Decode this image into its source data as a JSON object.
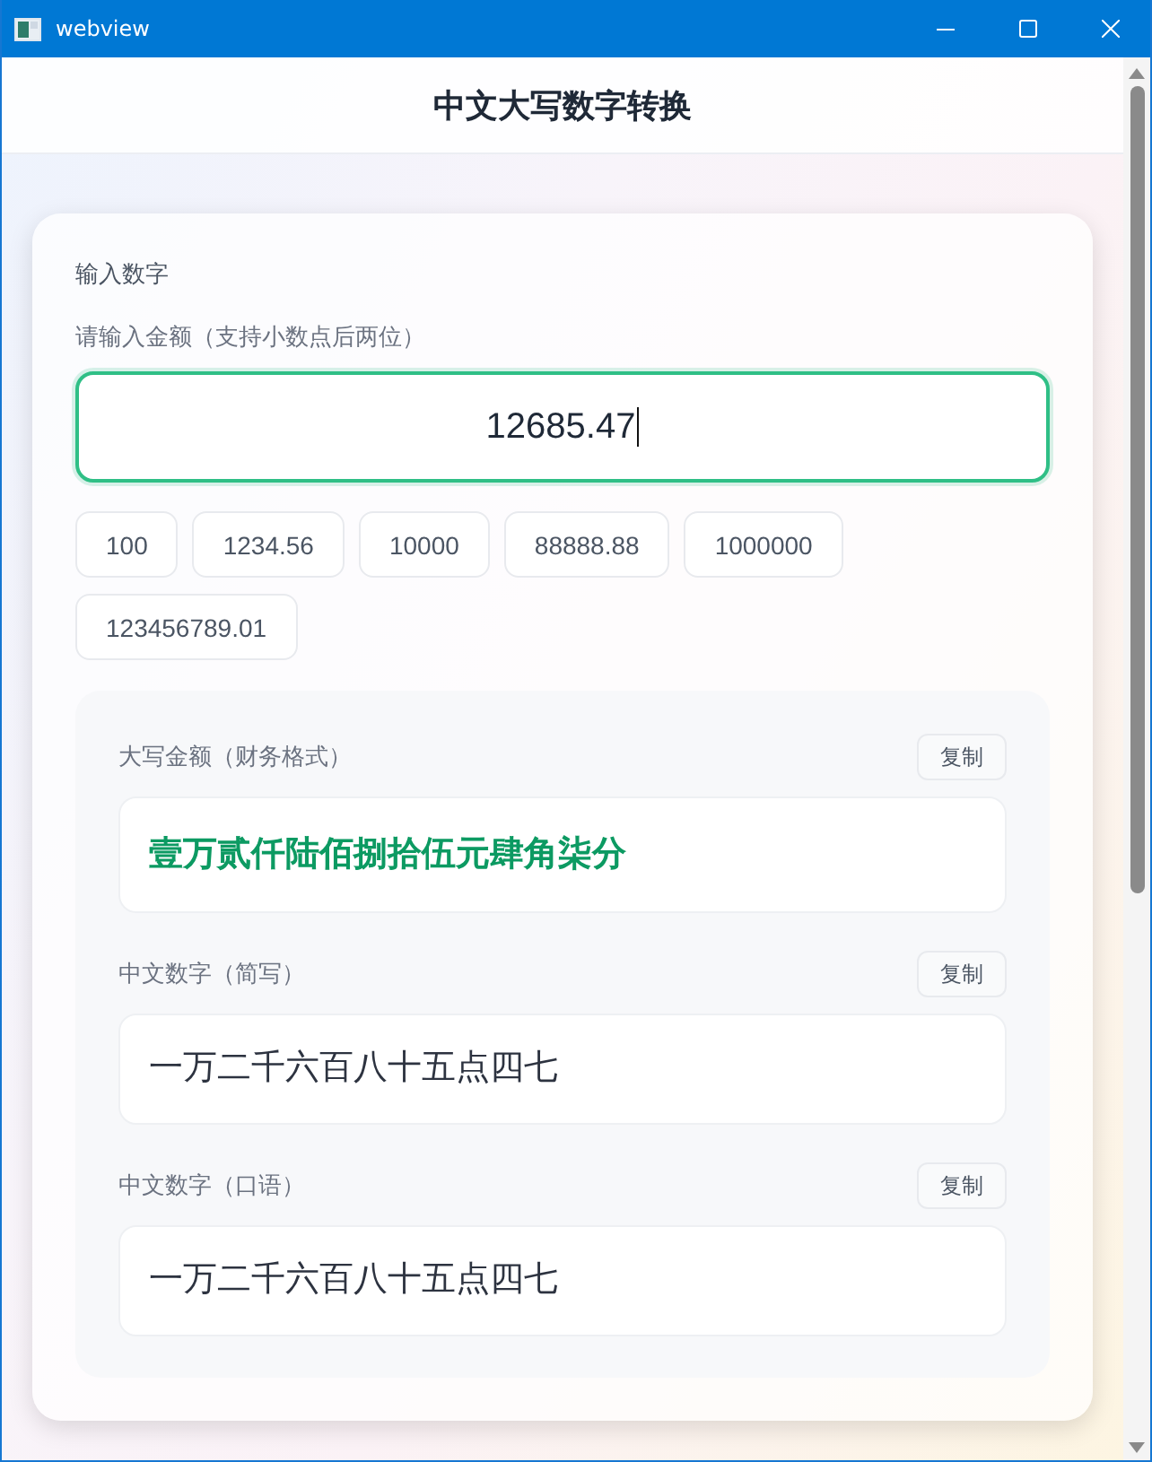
{
  "window": {
    "title": "webview"
  },
  "header": {
    "title": "中文大写数字转换"
  },
  "input_section": {
    "heading": "输入数字",
    "label": "请输入金额（支持小数点后两位）",
    "input": {
      "value": "12685.47",
      "focused": true
    },
    "presets": [
      "100",
      "1234.56",
      "10000",
      "88888.88",
      "1000000",
      "123456789.01"
    ]
  },
  "results": [
    {
      "kind": "financial",
      "label": "大写金额（财务格式）",
      "copy_button": "复制",
      "value": "壹万贰仟陆佰捌拾伍元肆角柒分"
    },
    {
      "kind": "plain",
      "label": "中文数字（简写）",
      "copy_button": "复制",
      "value": "一万二千六百八十五点四七"
    },
    {
      "kind": "plain",
      "label": "中文数字（口语）",
      "copy_button": "复制",
      "value": "一万二千六百八十五点四七"
    }
  ]
}
